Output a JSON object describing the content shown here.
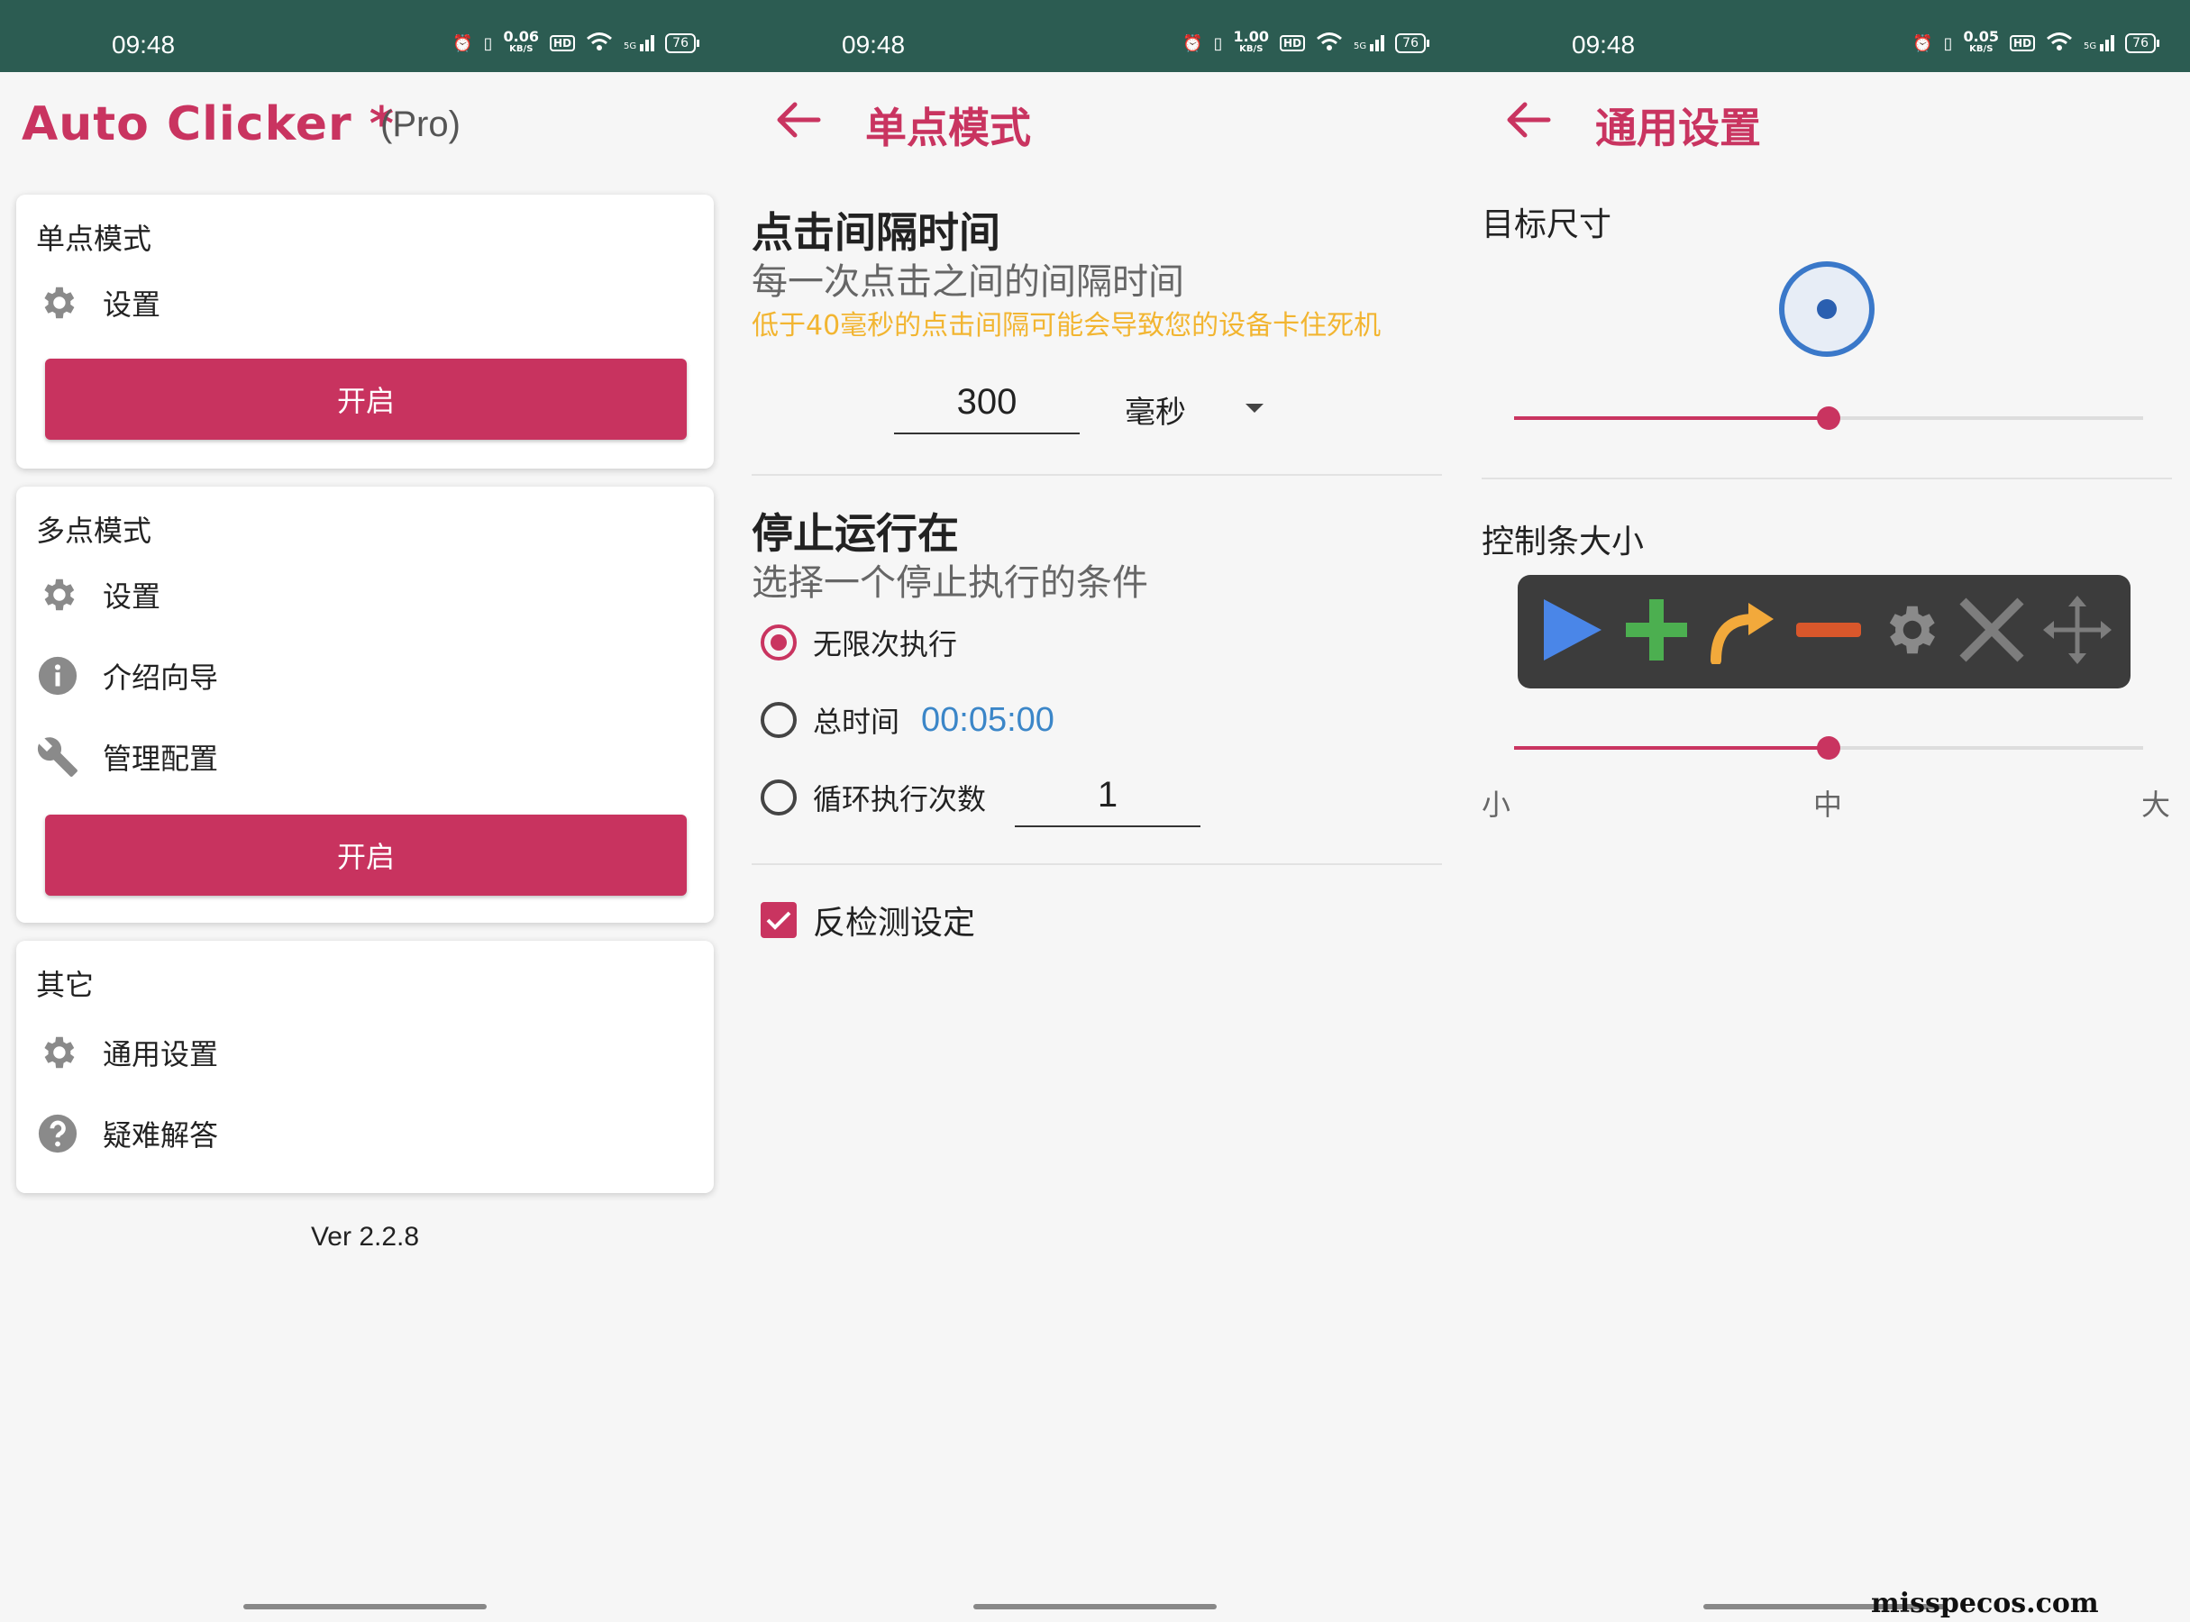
{
  "status_bars": [
    {
      "time": "09:48",
      "speed": "0.06",
      "speed_unit": "KB/S",
      "hd": "HD",
      "network": "5G",
      "battery": "76"
    },
    {
      "time": "09:48",
      "speed": "1.00",
      "speed_unit": "KB/S",
      "hd": "HD",
      "network": "5G",
      "battery": "76"
    },
    {
      "time": "09:48",
      "speed": "0.05",
      "speed_unit": "KB/S",
      "hd": "HD",
      "network": "5G",
      "battery": "76"
    }
  ],
  "colors": {
    "accent": "#c93460",
    "statusbar": "#2c5c52",
    "warning": "#f2b531",
    "link": "#3b86c8"
  },
  "home": {
    "title": "Auto Clicker *",
    "title_suffix": "(Pro)",
    "single_card": {
      "title": "单点模式",
      "settings": "设置",
      "start": "开启"
    },
    "multi_card": {
      "title": "多点模式",
      "settings": "设置",
      "guide": "介绍向导",
      "manage": "管理配置",
      "start": "开启"
    },
    "other_card": {
      "title": "其它",
      "general": "通用设置",
      "faq": "疑难解答"
    },
    "version": "Ver 2.2.8"
  },
  "single_mode": {
    "header": "单点模式",
    "interval": {
      "title": "点击间隔时间",
      "subtitle": "每一次点击之间的间隔时间",
      "warning": "低于40毫秒的点击间隔可能会导致您的设备卡住死机",
      "value": "300",
      "unit": "毫秒"
    },
    "stop": {
      "title": "停止运行在",
      "subtitle": "选择一个停止执行的条件",
      "options": [
        {
          "label": "无限次执行",
          "selected": true
        },
        {
          "label": "总时间",
          "value": "00:05:00",
          "selected": false
        },
        {
          "label": "循环执行次数",
          "value": "1",
          "selected": false
        }
      ]
    },
    "anti_detect": {
      "label": "反检测设定",
      "checked": true
    }
  },
  "general_settings": {
    "header": "通用设置",
    "target_size": {
      "label": "目标尺寸",
      "value": 0.5
    },
    "control_bar": {
      "label": "控制条大小",
      "value": 0.5,
      "icons": [
        "play-icon",
        "plus-icon",
        "redo-arrow-icon",
        "minus-icon",
        "gear-icon",
        "close-icon",
        "move-icon"
      ],
      "scale": {
        "small": "小",
        "mid": "中",
        "large": "大"
      }
    }
  },
  "watermark": "misspecos.com"
}
